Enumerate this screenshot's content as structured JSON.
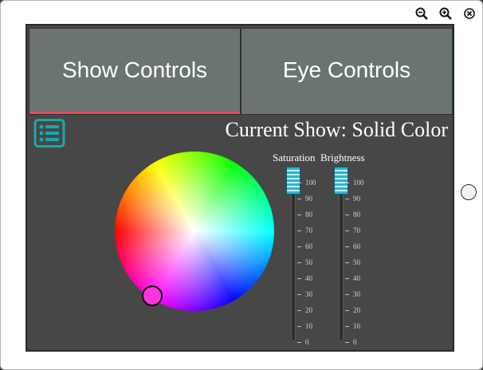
{
  "window": {
    "controls": [
      {
        "name": "zoom-out-icon"
      },
      {
        "name": "zoom-in-icon"
      },
      {
        "name": "close-icon"
      }
    ]
  },
  "tabs": [
    {
      "label": "Show Controls",
      "active": true
    },
    {
      "label": "Eye Controls",
      "active": false
    }
  ],
  "show": {
    "title": "Current Show: Solid Color",
    "menu_icon": "list-icon"
  },
  "color_picker": {
    "selected_color": "#ff33dd"
  },
  "sliders": [
    {
      "label": "Saturation",
      "value": 100,
      "min": 0,
      "max": 100
    },
    {
      "label": "Brightness",
      "value": 100,
      "min": 0,
      "max": 100
    }
  ],
  "slider_ticks": [
    "100",
    "90",
    "80",
    "70",
    "60",
    "50",
    "40",
    "30",
    "20",
    "10",
    "0"
  ],
  "colors": {
    "tab_background": "#6a7570",
    "active_tab_underline": "#e0505a",
    "accent": "#19a8a8",
    "app_background": "#474747",
    "slider_thumb": "#29b6d6"
  }
}
